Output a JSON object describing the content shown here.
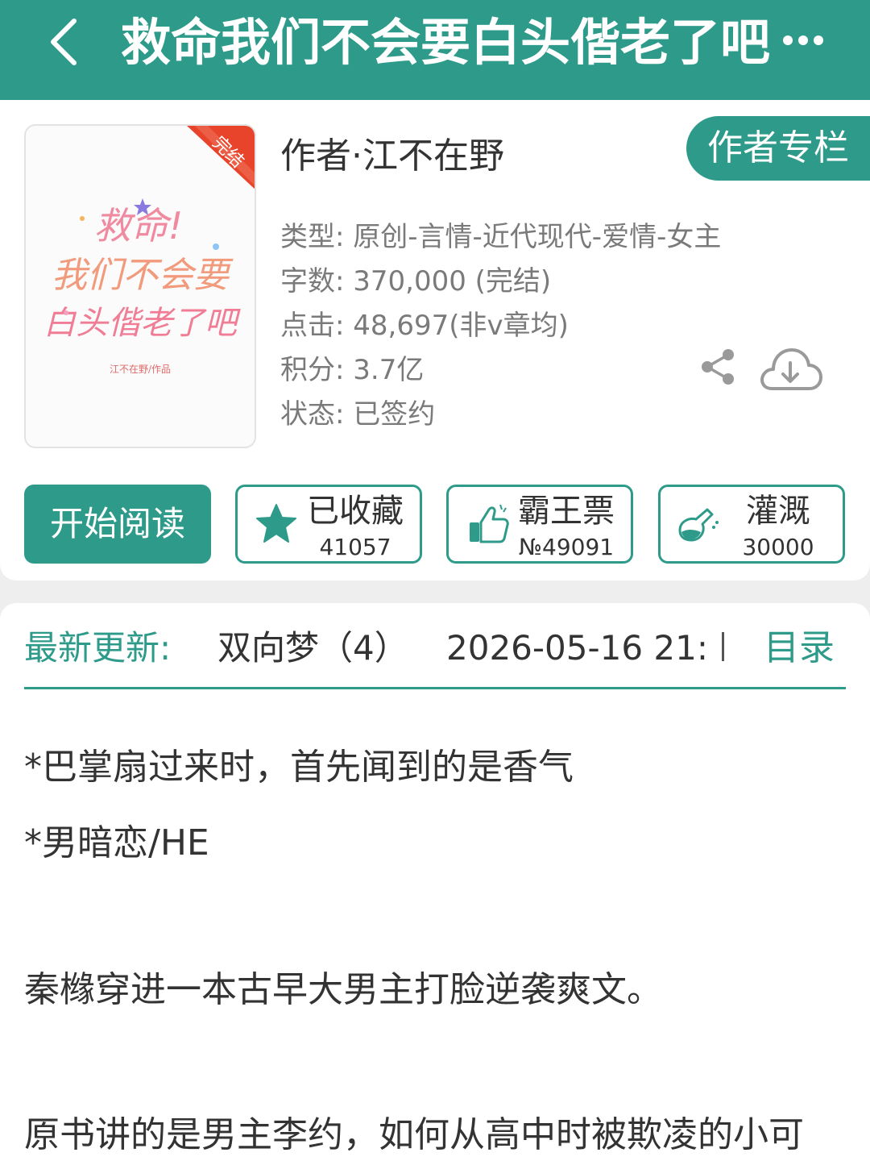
{
  "header": {
    "back_icon": "chevron-left-icon",
    "title": "救命我们不会要白头偕老了吧",
    "more_icon": "more-dots-icon"
  },
  "book": {
    "cover": {
      "badge": "完结",
      "title_lines": [
        "救命!",
        "我们不会要",
        "白头偕老了吧"
      ],
      "credit": "江不在野/作品"
    },
    "author_line": "作者·江不在野",
    "author_column_label": "作者专栏",
    "meta": {
      "type": "类型: 原创-言情-近代现代-爱情-女主",
      "words": "字数: 370,000 (完结)",
      "clicks": "点击: 48,697(非v章均)",
      "score": "积分: 3.7亿",
      "status": "状态: 已签约"
    },
    "share_icon": "share-icon",
    "download_icon": "cloud-download-icon"
  },
  "actions": {
    "read": "开始阅读",
    "collect": {
      "label": "已收藏",
      "count": "41057",
      "icon": "star-icon"
    },
    "vote": {
      "label": "霸王票",
      "count": "№49091",
      "icon": "thumbs-up-icon"
    },
    "water": {
      "label": "灌溉",
      "count": "30000",
      "icon": "watering-flask-icon"
    }
  },
  "update": {
    "label": "最新更新:",
    "chapter": "双向梦（4）",
    "time": "2026-05-16 21:1",
    "toc": "目录"
  },
  "description": [
    "*巴掌扇过来时，首先闻到的是香气",
    "*男暗恋/HE",
    "秦橼穿进一本古早大男主打脸逆袭爽文。",
    "原书讲的是男主李约，如何从高中时被欺凌的小可"
  ],
  "colors": {
    "accent": "#2e9b8a",
    "badge": "#e8432b",
    "text": "#333333",
    "meta_text": "#7a7a7a"
  }
}
